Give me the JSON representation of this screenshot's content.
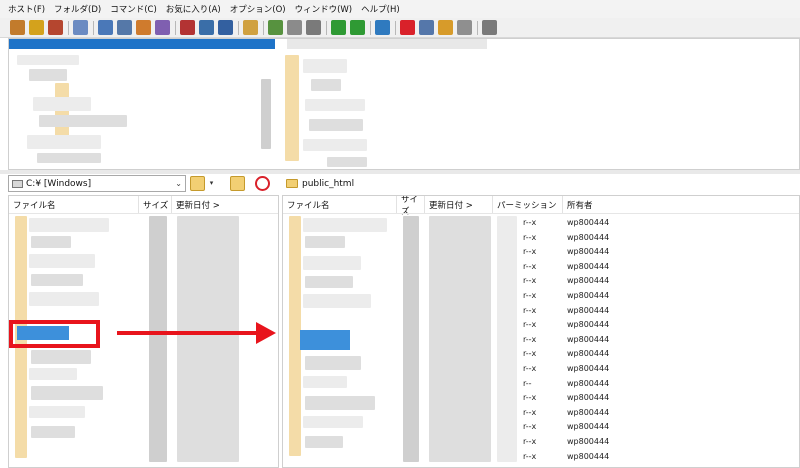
{
  "menubar": {
    "items": [
      "ホスト(F)",
      "フォルダ(D)",
      "コマンド(C)",
      "お気に入り(A)",
      "オプション(O)",
      "ウィンドウ(W)",
      "ヘルプ(H)"
    ]
  },
  "toolbar": {
    "icons": [
      {
        "name": "connect-icon",
        "color": "#c27b2c"
      },
      {
        "name": "quick-connect-icon",
        "color": "#d4a21c"
      },
      {
        "name": "disconnect-icon",
        "color": "#b5462f"
      },
      {
        "name": "sep"
      },
      {
        "name": "settings-icon",
        "color": "#6b8bc2"
      },
      {
        "name": "sep"
      },
      {
        "name": "list-view-icon",
        "color": "#4a78b8"
      },
      {
        "name": "detail-view-icon",
        "color": "#5578a8"
      },
      {
        "name": "sort-icon",
        "color": "#cf7b2d"
      },
      {
        "name": "filter-icon",
        "color": "#7f5fb0"
      },
      {
        "name": "sep"
      },
      {
        "name": "binary-mode-icon",
        "color": "#b33333"
      },
      {
        "name": "ascii-mode-icon",
        "color": "#3a6ea8"
      },
      {
        "name": "auto-mode-icon",
        "color": "#3360a0"
      },
      {
        "name": "sep"
      },
      {
        "name": "upload-download-icon",
        "color": "#d0a140"
      },
      {
        "name": "sep"
      },
      {
        "name": "mirror-upload-icon",
        "color": "#57923f"
      },
      {
        "name": "find-icon",
        "color": "#8b8b8b"
      },
      {
        "name": "stop-icon",
        "color": "#7a7a7a"
      },
      {
        "name": "sep"
      },
      {
        "name": "download-arrow-icon",
        "color": "#2f9a34"
      },
      {
        "name": "upload-arrow-icon",
        "color": "#2f9a34"
      },
      {
        "name": "sep"
      },
      {
        "name": "web-icon",
        "color": "#2f7abf"
      },
      {
        "name": "sep"
      },
      {
        "name": "delete-icon",
        "color": "#d9212a"
      },
      {
        "name": "rename-icon",
        "color": "#5577aa"
      },
      {
        "name": "mkdir-icon",
        "color": "#d79b2a"
      },
      {
        "name": "attributes-icon",
        "color": "#8f8f8f"
      },
      {
        "name": "sep"
      },
      {
        "name": "exit-icon",
        "color": "#7a7a7a"
      }
    ]
  },
  "local": {
    "path": "C:¥ [Windows]",
    "columns": {
      "name": "ファイル名",
      "size": "サイズ",
      "date": "更新日付 >"
    }
  },
  "remote": {
    "path": "public_html",
    "columns": {
      "name": "ファイル名",
      "size": "サイズ",
      "date": "更新日付 >",
      "perm": "パーミッション",
      "owner": "所有者"
    },
    "rows": [
      {
        "perm": "r--x",
        "owner": "wp800444"
      },
      {
        "perm": "r--x",
        "owner": "wp800444"
      },
      {
        "perm": "r--x",
        "owner": "wp800444"
      },
      {
        "perm": "r--x",
        "owner": "wp800444"
      },
      {
        "perm": "r--x",
        "owner": "wp800444"
      },
      {
        "perm": "r--x",
        "owner": "wp800444"
      },
      {
        "perm": "r--x",
        "owner": "wp800444"
      },
      {
        "perm": "r--x",
        "owner": "wp800444"
      },
      {
        "perm": "r--x",
        "owner": "wp800444"
      },
      {
        "perm": "r--x",
        "owner": "wp800444"
      },
      {
        "perm": "r--x",
        "owner": "wp800444"
      },
      {
        "perm": "r--",
        "owner": "wp800444"
      },
      {
        "perm": "r--x",
        "owner": "wp800444"
      },
      {
        "perm": "r--x",
        "owner": "wp800444"
      },
      {
        "perm": "r--x",
        "owner": "wp800444"
      },
      {
        "perm": "r--x",
        "owner": "wp800444"
      },
      {
        "perm": "r--x",
        "owner": "wp800444"
      }
    ]
  },
  "annotation": {
    "color": "#e8141c"
  }
}
